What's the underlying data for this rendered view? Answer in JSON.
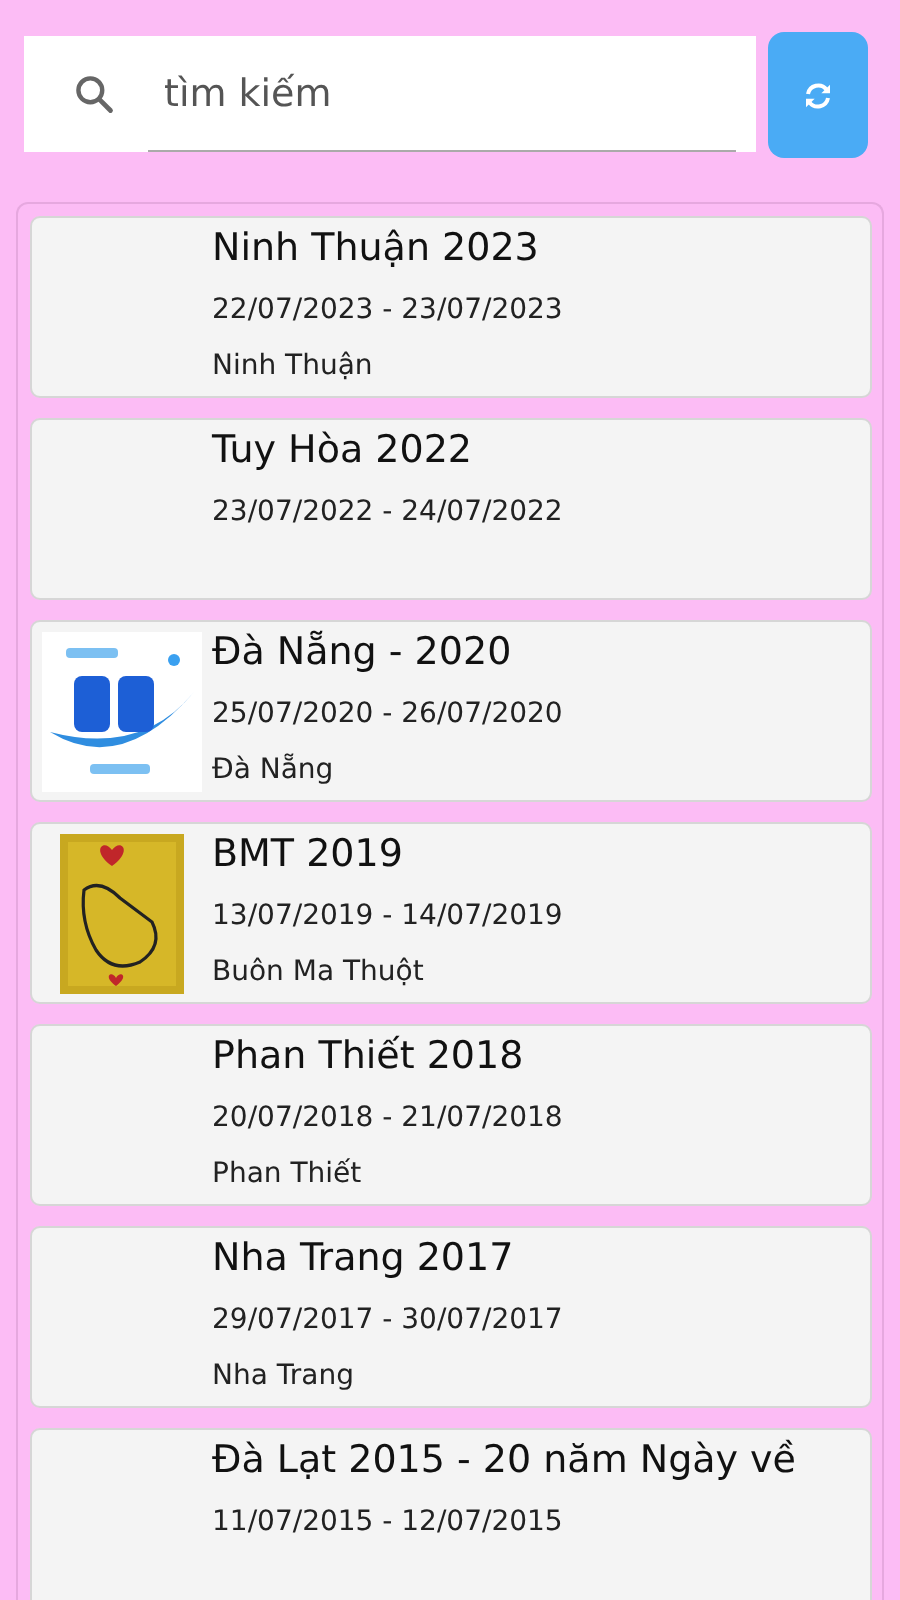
{
  "search": {
    "placeholder": "tìm kiếm"
  },
  "events": [
    {
      "title": "Ninh Thuận 2023",
      "dates": "22/07/2023 - 23/07/2023",
      "location": "Ninh Thuận"
    },
    {
      "title": "Tuy Hòa 2022",
      "dates": "23/07/2022 - 24/07/2022"
    },
    {
      "title": "Đà Nẵng - 2020",
      "dates": "25/07/2020 - 26/07/2020",
      "location": "Đà Nẵng"
    },
    {
      "title": "BMT 2019",
      "dates": "13/07/2019 - 14/07/2019",
      "location": "Buôn Ma Thuột"
    },
    {
      "title": "Phan Thiết 2018",
      "dates": "20/07/2018 - 21/07/2018",
      "location": "Phan Thiết"
    },
    {
      "title": "Nha Trang 2017",
      "dates": "29/07/2017 - 30/07/2017",
      "location": "Nha Trang"
    },
    {
      "title": "Đà Lạt 2015 - 20 năm Ngày về",
      "dates": "11/07/2015 - 12/07/2015"
    }
  ]
}
